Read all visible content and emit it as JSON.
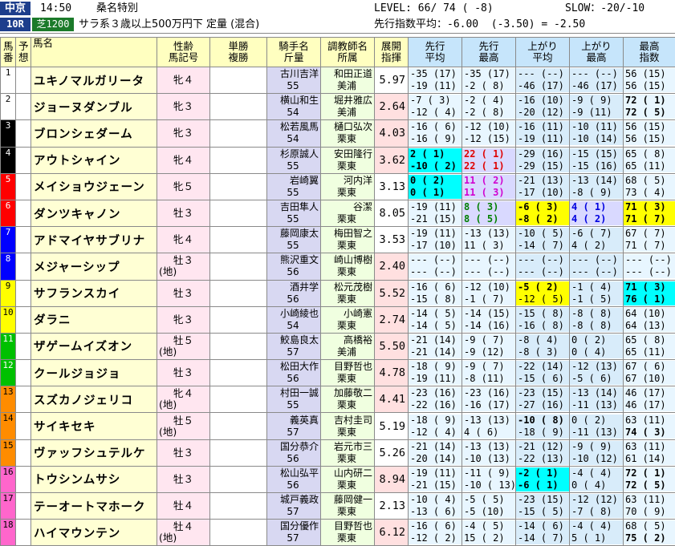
{
  "header": {
    "venue": "中京",
    "time": "14:50",
    "race_name": "桑名特別",
    "level": "LEVEL: 66/ 74 ( -8)",
    "slow": "SLOW：-20/-10",
    "race_no": "10R",
    "course": "芝1200",
    "conditions": "サラ系３歳以上500万円下 定量 (混合)",
    "pace": "先行指数平均：-6.00  (-3.50) = -2.50"
  },
  "columns": [
    "馬番",
    "予想",
    "馬名",
    "性齢\n馬記号",
    "単勝\n複勝",
    "騎手名\n斤量",
    "調教師名\n所属",
    "展開\n指揮",
    "先行\n平均",
    "先行\n最高",
    "上がり\n平均",
    "上がり\n最高",
    "最高\n指数"
  ],
  "rows": [
    {
      "no": "1",
      "name": "ユキノマルガリータ",
      "sex": "牝４",
      "sex2": "",
      "jockey": "古川吉洋",
      "kg": "55",
      "trainer": "和田正道",
      "area": "美浦",
      "ix": "5.97",
      "s1a": "-35 (17)",
      "s1b": "-19 (11)",
      "s2a": "-35 (17)",
      "s2b": "-2 ( 8)",
      "s3a": "--- (--)",
      "s3b": "-46 (17)",
      "s4a": "--- (--)",
      "s4b": "-46 (17)",
      "s5a": "56 (15)",
      "s5b": "56 (15)"
    },
    {
      "no": "2",
      "name": "ジョーヌダンブル",
      "sex": "牝３",
      "sex2": "",
      "jockey": "横山和生",
      "kg": "54",
      "trainer": "堀井雅広",
      "area": "美浦",
      "ix": "2.64",
      "s1a": "-7 ( 3)",
      "s1b": "-12 ( 4)",
      "s2a": "-2 ( 4)",
      "s2b": "-2 ( 8)",
      "s3a": "-16 (10)",
      "s3b": "-20 (12)",
      "s4a": "-9 ( 9)",
      "s4b": "-9 (11)",
      "s5a": "72 ( 1)",
      "s5b": "72 ( 5)"
    },
    {
      "no": "3",
      "name": "ブロンシェダーム",
      "sex": "牝３",
      "sex2": "",
      "jockey": "松若風馬",
      "kg": "54",
      "trainer": "樋口弘次",
      "area": "栗東",
      "ix": "4.03",
      "s1a": "-16 ( 6)",
      "s1b": "-16 ( 9)",
      "s2a": "-12 (10)",
      "s2b": "-12 (15)",
      "s3a": "-16 (11)",
      "s3b": "-19 (11)",
      "s4a": "-10 (11)",
      "s4b": "-10 (14)",
      "s5a": "56 (15)",
      "s5b": "56 (15)"
    },
    {
      "no": "4",
      "name": "アウトシャイン",
      "sex": "牝４",
      "sex2": "",
      "jockey": "杉原誠人",
      "kg": "55",
      "trainer": "安田隆行",
      "area": "栗東",
      "ix": "3.62",
      "s1a": "2 ( 1)",
      "s1b": "-10 ( 2)",
      "s2a": "22 ( 1)",
      "s2b": "22 ( 1)",
      "s3a": "-29 (16)",
      "s3b": "-29 (15)",
      "s4a": "-15 (15)",
      "s4b": "-15 (16)",
      "s5a": "65 ( 8)",
      "s5b": "65 (11)"
    },
    {
      "no": "5",
      "name": "メイショウジェーン",
      "sex": "牝５",
      "sex2": "",
      "jockey": "岩崎翼",
      "kg": "55",
      "trainer": "河内洋",
      "area": "栗東",
      "ix": "3.13",
      "s1a": "0 ( 2)",
      "s1b": "0 ( 1)",
      "s2a": "11 ( 2)",
      "s2b": "11 ( 3)",
      "s3a": "-21 (13)",
      "s3b": "-17 (10)",
      "s4a": "-13 (14)",
      "s4b": "-8 ( 9)",
      "s5a": "68 ( 5)",
      "s5b": "73 ( 4)"
    },
    {
      "no": "6",
      "name": "ダンツキャノン",
      "sex": "牡３",
      "sex2": "",
      "jockey": "吉田隼人",
      "kg": "55",
      "trainer": "谷潔",
      "area": "栗東",
      "ix": "8.05",
      "s1a": "-19 (11)",
      "s1b": "-21 (15)",
      "s2a": "8 ( 3)",
      "s2b": "8 ( 5)",
      "s3a": "-6 ( 3)",
      "s3b": "-8 ( 2)",
      "s4a": "4 ( 1)",
      "s4b": "4 ( 2)",
      "s5a": "71 ( 3)",
      "s5b": "71 ( 7)"
    },
    {
      "no": "7",
      "name": "アドマイヤサブリナ",
      "sex": "牝４",
      "sex2": "",
      "jockey": "藤岡康太",
      "kg": "55",
      "trainer": "梅田智之",
      "area": "栗東",
      "ix": "3.53",
      "s1a": "-19 (11)",
      "s1b": "-17 (10)",
      "s2a": "-13 (13)",
      "s2b": "11 ( 3)",
      "s3a": "-10 ( 5)",
      "s3b": "-14 ( 7)",
      "s4a": "-6 ( 7)",
      "s4b": "4 ( 2)",
      "s5a": "67 ( 7)",
      "s5b": "71 ( 7)"
    },
    {
      "no": "8",
      "name": "メジャーシップ",
      "sex": "牡３",
      "sex2": "(地)",
      "jockey": "熊沢重文",
      "kg": "56",
      "trainer": "崎山博樹",
      "area": "栗東",
      "ix": "2.40",
      "s1a": "--- (--)",
      "s1b": "--- (--)",
      "s2a": "--- (--)",
      "s2b": "--- (--)",
      "s3a": "--- (--)",
      "s3b": "--- (--)",
      "s4a": "--- (--)",
      "s4b": "--- (--)",
      "s5a": "--- (--)",
      "s5b": "--- (--)"
    },
    {
      "no": "9",
      "name": "サフランスカイ",
      "sex": "牡３",
      "sex2": "",
      "jockey": "酒井学",
      "kg": "56",
      "trainer": "松元茂樹",
      "area": "栗東",
      "ix": "5.52",
      "s1a": "-16 ( 6)",
      "s1b": "-15 ( 8)",
      "s2a": "-12 (10)",
      "s2b": "-1 ( 7)",
      "s3a": "-5 ( 2)",
      "s3b": "-12 ( 5)",
      "s4a": "-1 ( 4)",
      "s4b": "-1 ( 5)",
      "s5a": "71 ( 3)",
      "s5b": "76 ( 1)"
    },
    {
      "no": "10",
      "name": "ダラニ",
      "sex": "牝３",
      "sex2": "",
      "jockey": "小崎綾也",
      "kg": "54",
      "trainer": "小崎憲",
      "area": "栗東",
      "ix": "2.74",
      "s1a": "-14 ( 5)",
      "s1b": "-14 ( 5)",
      "s2a": "-14 (15)",
      "s2b": "-14 (16)",
      "s3a": "-15 ( 8)",
      "s3b": "-16 ( 8)",
      "s4a": "-8 ( 8)",
      "s4b": "-8 ( 8)",
      "s5a": "64 (10)",
      "s5b": "64 (13)"
    },
    {
      "no": "11",
      "name": "ザゲームイズオン",
      "sex": "牡５",
      "sex2": "(地)",
      "jockey": "鮫島良太",
      "kg": "57",
      "trainer": "高橋裕",
      "area": "美浦",
      "ix": "5.50",
      "s1a": "-21 (14)",
      "s1b": "-21 (14)",
      "s2a": "-9 ( 7)",
      "s2b": "-9 (12)",
      "s3a": "-8 ( 4)",
      "s3b": "-8 ( 3)",
      "s4a": "0 ( 2)",
      "s4b": "0 ( 4)",
      "s5a": "65 ( 8)",
      "s5b": "65 (11)"
    },
    {
      "no": "12",
      "name": "クールジョジョ",
      "sex": "牡３",
      "sex2": "",
      "jockey": "松田大作",
      "kg": "56",
      "trainer": "目野哲也",
      "area": "栗東",
      "ix": "4.78",
      "s1a": "-18 ( 9)",
      "s1b": "-19 (11)",
      "s2a": "-9 ( 7)",
      "s2b": "-8 (11)",
      "s3a": "-22 (14)",
      "s3b": "-15 ( 6)",
      "s4a": "-12 (13)",
      "s4b": "-5 ( 6)",
      "s5a": "67 ( 6)",
      "s5b": "67 (10)"
    },
    {
      "no": "13",
      "name": "スズカノジェリコ",
      "sex": "牝４",
      "sex2": "(地)",
      "jockey": "村田一誠",
      "kg": "55",
      "trainer": "加藤敬二",
      "area": "栗東",
      "ix": "4.41",
      "s1a": "-23 (16)",
      "s1b": "-22 (16)",
      "s2a": "-23 (16)",
      "s2b": "-16 (17)",
      "s3a": "-23 (15)",
      "s3b": "-27 (16)",
      "s4a": "-13 (14)",
      "s4b": "-11 (13)",
      "s5a": "46 (17)",
      "s5b": "46 (17)"
    },
    {
      "no": "14",
      "name": "サイキセキ",
      "sex": "牡５",
      "sex2": "(地)",
      "jockey": "義英真",
      "kg": "57",
      "trainer": "吉村圭司",
      "area": "栗東",
      "ix": "5.19",
      "s1a": "-18 ( 9)",
      "s1b": "-12 ( 4)",
      "s2a": "-13 (13)",
      "s2b": "4 ( 6)",
      "s3a": "-10 ( 8)",
      "s3b": "-18 ( 9)",
      "s4a": "0 ( 2)",
      "s4b": "-11 (13)",
      "s5a": "63 (11)",
      "s5b": "74 ( 3)"
    },
    {
      "no": "15",
      "name": "ヴァッフシュテルケ",
      "sex": "牡３",
      "sex2": "",
      "jockey": "国分恭介",
      "kg": "56",
      "trainer": "岩元市三",
      "area": "栗東",
      "ix": "5.26",
      "s1a": "-21 (14)",
      "s1b": "-20 (14)",
      "s2a": "-13 (13)",
      "s2b": "-10 (13)",
      "s3a": "-21 (12)",
      "s3b": "-22 (13)",
      "s4a": "-9 ( 9)",
      "s4b": "-10 (12)",
      "s5a": "63 (11)",
      "s5b": "61 (14)"
    },
    {
      "no": "16",
      "name": "トウシンムサシ",
      "sex": "牡３",
      "sex2": "",
      "jockey": "松山弘平",
      "kg": "56",
      "trainer": "山内研二",
      "area": "栗東",
      "ix": "8.94",
      "s1a": "-19 (11)",
      "s1b": "-21 (15)",
      "s2a": "-11 ( 9)",
      "s2b": "-10 ( 13)",
      "s3a": "-2 ( 1)",
      "s3b": "-6 ( 1)",
      "s4a": "-4 ( 4)",
      "s4b": "0 ( 4)",
      "s5a": "72 ( 1)",
      "s5b": "72 ( 5)"
    },
    {
      "no": "17",
      "name": "テーオートマホーク",
      "sex": "牡４",
      "sex2": "",
      "jockey": "城戸義政",
      "kg": "57",
      "trainer": "藤岡健一",
      "area": "栗東",
      "ix": "2.13",
      "s1a": "-10 ( 4)",
      "s1b": "-13 ( 6)",
      "s2a": "-5 ( 5)",
      "s2b": "-5 (10)",
      "s3a": "-23 (15)",
      "s3b": "-15 ( 5)",
      "s4a": "-12 (12)",
      "s4b": "-7 ( 8)",
      "s5a": "63 (11)",
      "s5b": "70 ( 9)"
    },
    {
      "no": "18",
      "name": "ハイマウンテン",
      "sex": "牡４",
      "sex2": "(地)",
      "jockey": "国分優作",
      "kg": "57",
      "trainer": "目野哲也",
      "area": "栗東",
      "ix": "6.12",
      "s1a": "-16 ( 6)",
      "s1b": "-12 ( 2)",
      "s2a": "-4 ( 5)",
      "s2b": "15 ( 2)",
      "s3a": "-14 ( 6)",
      "s3b": "-14 ( 7)",
      "s4a": "-4 ( 4)",
      "s4b": "5 ( 1)",
      "s5a": "68 ( 5)",
      "s5b": "75 ( 2)"
    }
  ],
  "colors": {
    "frame": [
      "#ffffff",
      "#ffffff",
      "#000000",
      "#000000",
      "#ff0000",
      "#ff0000",
      "#0000ff",
      "#0000ff",
      "#ffff00",
      "#ffff00",
      "#00c000",
      "#00c000",
      "#ff8c00",
      "#ff8c00",
      "#ff8c00",
      "#ff66cc",
      "#ff66cc",
      "#ff66cc"
    ]
  }
}
